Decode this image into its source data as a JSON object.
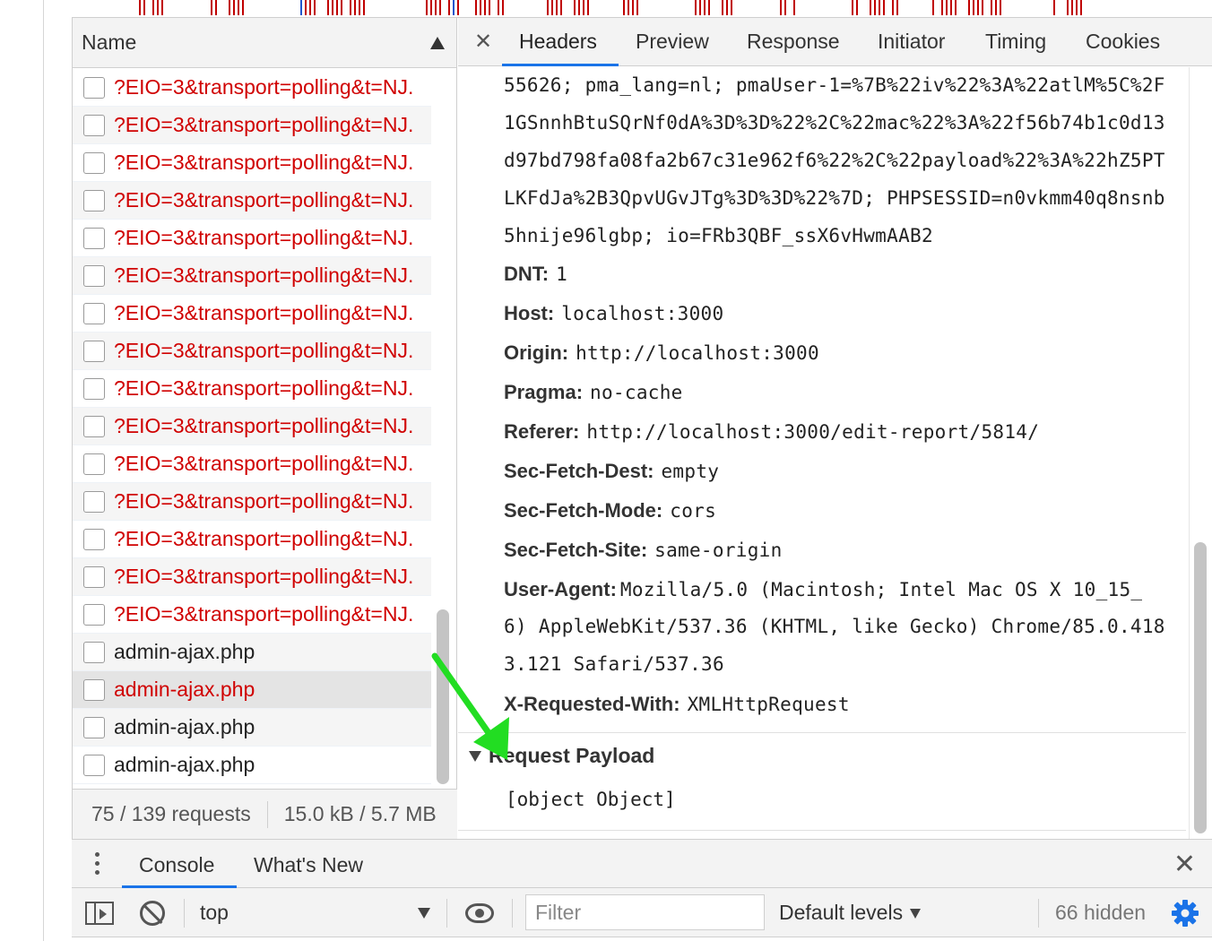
{
  "name_pane": {
    "header": "Name",
    "rows": [
      {
        "name": "?EIO=3&transport=polling&t=NJ.",
        "error": true
      },
      {
        "name": "?EIO=3&transport=polling&t=NJ.",
        "error": true
      },
      {
        "name": "?EIO=3&transport=polling&t=NJ.",
        "error": true
      },
      {
        "name": "?EIO=3&transport=polling&t=NJ.",
        "error": true
      },
      {
        "name": "?EIO=3&transport=polling&t=NJ.",
        "error": true
      },
      {
        "name": "?EIO=3&transport=polling&t=NJ.",
        "error": true
      },
      {
        "name": "?EIO=3&transport=polling&t=NJ.",
        "error": true
      },
      {
        "name": "?EIO=3&transport=polling&t=NJ.",
        "error": true
      },
      {
        "name": "?EIO=3&transport=polling&t=NJ.",
        "error": true
      },
      {
        "name": "?EIO=3&transport=polling&t=NJ.",
        "error": true
      },
      {
        "name": "?EIO=3&transport=polling&t=NJ.",
        "error": true
      },
      {
        "name": "?EIO=3&transport=polling&t=NJ.",
        "error": true
      },
      {
        "name": "?EIO=3&transport=polling&t=NJ.",
        "error": true
      },
      {
        "name": "?EIO=3&transport=polling&t=NJ.",
        "error": true
      },
      {
        "name": "?EIO=3&transport=polling&t=NJ.",
        "error": true
      },
      {
        "name": "admin-ajax.php",
        "error": false
      },
      {
        "name": "admin-ajax.php",
        "error": true,
        "selected": true
      },
      {
        "name": "admin-ajax.php",
        "error": false
      },
      {
        "name": "admin-ajax.php",
        "error": false
      }
    ],
    "footer": {
      "requests": "75 / 139 requests",
      "size": "15.0 kB / 5.7 MB"
    }
  },
  "details": {
    "tabs": [
      "Headers",
      "Preview",
      "Response",
      "Initiator",
      "Timing",
      "Cookies"
    ],
    "active_tab": "Headers",
    "cookie_lines": [
      "55626; pma_lang=nl; pmaUser-1=%7B%22iv%22%3A%22atlM%5C%2F",
      "1GSnnhBtuSQrNf0dA%3D%3D%22%2C%22mac%22%3A%22f56b74b1c0d13",
      "d97bd798fa08fa2b67c31e962f6%22%2C%22payload%22%3A%22hZ5PT",
      "LKFdJa%2B3QpvUGvJTg%3D%3D%22%7D; PHPSESSID=n0vkmm40q8nsnb",
      "5hnije96lgbp; io=FRb3QBF_ssX6vHwmAAB2"
    ],
    "headers": [
      {
        "key": "DNT:",
        "value": "1"
      },
      {
        "key": "Host:",
        "value": "localhost:3000"
      },
      {
        "key": "Origin:",
        "value": "http://localhost:3000"
      },
      {
        "key": "Pragma:",
        "value": "no-cache"
      },
      {
        "key": "Referer:",
        "value": "http://localhost:3000/edit-report/5814/"
      },
      {
        "key": "Sec-Fetch-Dest:",
        "value": "empty"
      },
      {
        "key": "Sec-Fetch-Mode:",
        "value": "cors"
      },
      {
        "key": "Sec-Fetch-Site:",
        "value": "same-origin"
      },
      {
        "key": "User-Agent:",
        "value": "Mozilla/5.0 (Macintosh; Intel Mac OS X 10_15_"
      }
    ],
    "ua_continuation": [
      "6) AppleWebKit/537.36 (KHTML, like Gecko) Chrome/85.0.418",
      "3.121 Safari/537.36"
    ],
    "x_requested": {
      "key": "X-Requested-With:",
      "value": "XMLHttpRequest"
    },
    "payload_title": "Request Payload",
    "payload_value": "[object Object]"
  },
  "drawer": {
    "tabs": [
      "Console",
      "What's New"
    ],
    "active_tab": "Console",
    "context": "top",
    "filter_placeholder": "Filter",
    "levels": "Default levels",
    "hidden": "66 hidden"
  },
  "colors": {
    "error_text": "#d00000",
    "accent": "#1a73e8",
    "annotation_arrow": "#22dd22"
  }
}
